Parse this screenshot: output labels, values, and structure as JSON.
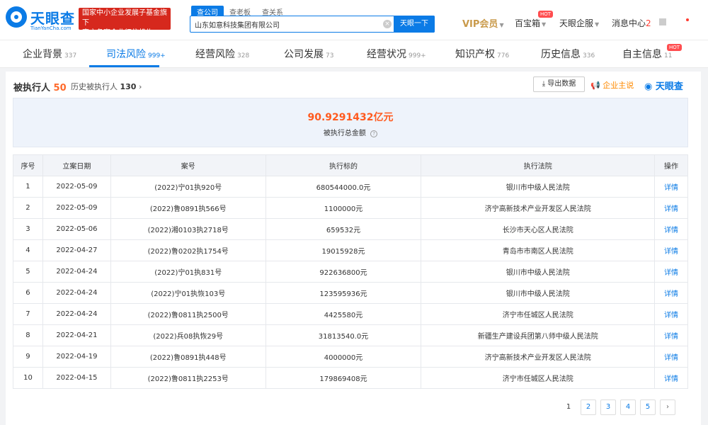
{
  "header": {
    "logo_title": "天眼查",
    "logo_sub": "TianYanCha.com",
    "gov_line1": "国家中小企业发展子基金旗下",
    "gov_line2": "官方备案企业征信机构",
    "search_tabs": [
      "查公司",
      "查老板",
      "查关系"
    ],
    "search_value": "山东如意科技集团有限公司",
    "search_button": "天眼一下",
    "vip": "VIP会员",
    "treasure": "百宝箱",
    "treasure_badge": "HOT",
    "enterprise": "天眼企服",
    "messages": "消息中心",
    "messages_count": "2"
  },
  "tabs": [
    {
      "label": "企业背景",
      "count": "337"
    },
    {
      "label": "司法风险",
      "count": "999+"
    },
    {
      "label": "经营风险",
      "count": "328"
    },
    {
      "label": "公司发展",
      "count": "73"
    },
    {
      "label": "经营状况",
      "count": "999+"
    },
    {
      "label": "知识产权",
      "count": "776"
    },
    {
      "label": "历史信息",
      "count": "336"
    },
    {
      "label": "自主信息",
      "count": "11",
      "badge": "HOT"
    }
  ],
  "section": {
    "title": "被执行人",
    "count": "50",
    "history_label": "历史被执行人",
    "history_count": "130",
    "export_label": "导出数据",
    "claim_label": "企业主说",
    "brand": "天眼查",
    "total_amount": "90.9291432亿元",
    "total_label": "被执行总金额"
  },
  "table": {
    "headers": [
      "序号",
      "立案日期",
      "案号",
      "执行标的",
      "执行法院",
      "操作"
    ],
    "rows": [
      [
        "1",
        "2022-05-09",
        "(2022)宁01执920号",
        "680544000.0元",
        "银川市中级人民法院",
        "详情"
      ],
      [
        "2",
        "2022-05-09",
        "(2022)鲁0891执566号",
        "1100000元",
        "济宁高新技术产业开发区人民法院",
        "详情"
      ],
      [
        "3",
        "2022-05-06",
        "(2022)湘0103执2718号",
        "659532元",
        "长沙市天心区人民法院",
        "详情"
      ],
      [
        "4",
        "2022-04-27",
        "(2022)鲁0202执1754号",
        "19015928元",
        "青岛市市南区人民法院",
        "详情"
      ],
      [
        "5",
        "2022-04-24",
        "(2022)宁01执831号",
        "922636800元",
        "银川市中级人民法院",
        "详情"
      ],
      [
        "6",
        "2022-04-24",
        "(2022)宁01执恢103号",
        "123595936元",
        "银川市中级人民法院",
        "详情"
      ],
      [
        "7",
        "2022-04-24",
        "(2022)鲁0811执2500号",
        "4425580元",
        "济宁市任城区人民法院",
        "详情"
      ],
      [
        "8",
        "2022-04-21",
        "(2022)兵08执恢29号",
        "31813540.0元",
        "新疆生产建设兵团第八师中级人民法院",
        "详情"
      ],
      [
        "9",
        "2022-04-19",
        "(2022)鲁0891执448号",
        "4000000元",
        "济宁高新技术产业开发区人民法院",
        "详情"
      ],
      [
        "10",
        "2022-04-15",
        "(2022)鲁0811执2253号",
        "179869408元",
        "济宁市任城区人民法院",
        "详情"
      ]
    ]
  },
  "pager": {
    "pages": [
      "1",
      "2",
      "3",
      "4",
      "5"
    ],
    "next": "›"
  }
}
